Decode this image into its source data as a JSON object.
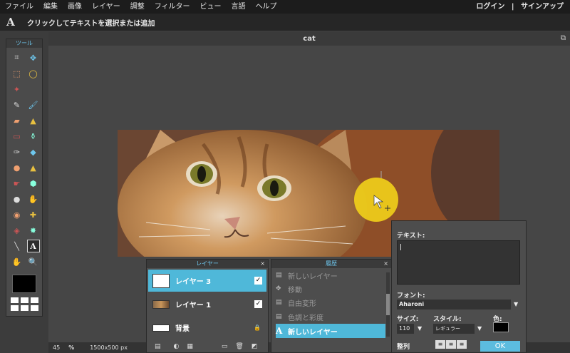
{
  "menubar": {
    "items": [
      "ファイル",
      "編集",
      "画像",
      "レイヤー",
      "調整",
      "フィルター",
      "ビュー",
      "言語",
      "ヘルプ"
    ],
    "login": "ログイン",
    "separator": "|",
    "signup": "サインアップ"
  },
  "options_bar": {
    "tool_glyph": "A",
    "hint": "クリックしてテキストを選択または追加"
  },
  "toolbox": {
    "title": "ツール",
    "tools": [
      {
        "name": "crop-icon",
        "glyph": "⌗"
      },
      {
        "name": "move-icon",
        "glyph": "✥"
      },
      {
        "name": "marquee-icon",
        "glyph": "⬚"
      },
      {
        "name": "lasso-icon",
        "glyph": "◯"
      },
      {
        "name": "magic-wand-icon",
        "glyph": "✦"
      },
      {
        "name": "blank",
        "glyph": ""
      },
      {
        "name": "pencil-icon",
        "glyph": "✎"
      },
      {
        "name": "brush-icon",
        "glyph": "🖌"
      },
      {
        "name": "eraser-icon",
        "glyph": "▰"
      },
      {
        "name": "bucket-icon",
        "glyph": "▲"
      },
      {
        "name": "gradient-icon",
        "glyph": "▭"
      },
      {
        "name": "stamp-icon",
        "glyph": "⚱"
      },
      {
        "name": "color-replace-icon",
        "glyph": "✑"
      },
      {
        "name": "shape-icon",
        "glyph": "◆"
      },
      {
        "name": "blur-icon",
        "glyph": "●"
      },
      {
        "name": "sharpen-icon",
        "glyph": "▲"
      },
      {
        "name": "smudge-icon",
        "glyph": "☛"
      },
      {
        "name": "sponge-icon",
        "glyph": "⬢"
      },
      {
        "name": "dodge-icon",
        "glyph": "●"
      },
      {
        "name": "burn-icon",
        "glyph": "✋"
      },
      {
        "name": "red-eye-icon",
        "glyph": "◉"
      },
      {
        "name": "spot-heal-icon",
        "glyph": "✚"
      },
      {
        "name": "bloat-icon",
        "glyph": "◈"
      },
      {
        "name": "pinch-icon",
        "glyph": "✸"
      },
      {
        "name": "eyedropper-icon",
        "glyph": "╲"
      },
      {
        "name": "text-tool-icon",
        "glyph": "A"
      },
      {
        "name": "hand-icon",
        "glyph": "✋"
      },
      {
        "name": "zoom-icon",
        "glyph": "🔍"
      }
    ],
    "colors": {
      "primary": "#000000"
    }
  },
  "workspace": {
    "title": "cat",
    "window_icon": "⧉",
    "status": {
      "zoom": "45",
      "zoom_unit": "%",
      "dims": "1500x500 px"
    }
  },
  "layers_panel": {
    "title": "レイヤー",
    "close": "×",
    "rows": [
      {
        "label": "レイヤー 3",
        "check": "✓"
      },
      {
        "label": "レイヤー 1",
        "check": "✓"
      },
      {
        "label": "背景",
        "lock": "🔒"
      }
    ],
    "footer": [
      "▤",
      "◐",
      "▦",
      "▭",
      "🗑",
      "◩"
    ]
  },
  "history_panel": {
    "title": "履歴",
    "close": "×",
    "items": [
      {
        "label": "新しいレイヤー",
        "icon": "▤"
      },
      {
        "label": "移動",
        "icon": "✥"
      },
      {
        "label": "自由変形",
        "icon": "▤"
      },
      {
        "label": "色調と彩度",
        "icon": "▤"
      },
      {
        "label": "新しいレイヤー",
        "icon": "A"
      }
    ]
  },
  "text_panel": {
    "text_label": "テキスト:",
    "font_label": "フォント:",
    "font_value": "Aharoni",
    "size_label": "サイズ:",
    "size_value": "110",
    "style_label": "スタイル:",
    "style_value": "レギュラー",
    "color_label": "色:",
    "color_value": "#000000",
    "align_label": "整列",
    "align_icons": [
      "≡",
      "≡",
      "≡"
    ],
    "ok_label": "OK"
  }
}
